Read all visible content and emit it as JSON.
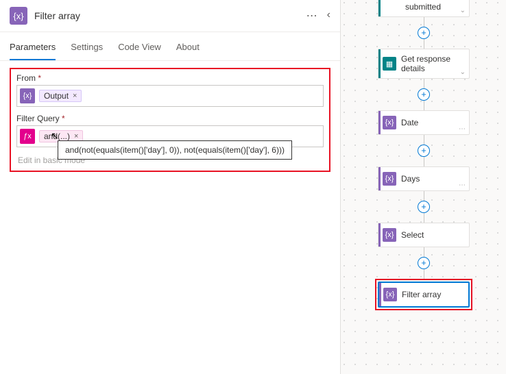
{
  "panel": {
    "title": "Filter array",
    "icon_glyph": "{x}",
    "tabs": [
      "Parameters",
      "Settings",
      "Code View",
      "About"
    ],
    "active_tab": 0
  },
  "form": {
    "from_label": "From",
    "from_token": "Output",
    "query_label": "Filter Query",
    "query_token": "and(...)",
    "edit_link": "Edit in basic mode"
  },
  "tooltip": "and(not(equals(item()['day'], 0)), not(equals(item()['day'], 6)))",
  "flow_nodes": {
    "n0": "submitted",
    "n1": "Get response details",
    "n2": "Date",
    "n3": "Days",
    "n4": "Select",
    "n5": "Filter array"
  },
  "glyphs": {
    "plus": "+",
    "x": "×",
    "dots": "⋯",
    "chevron_left": "‹",
    "caret": "⌄",
    "cursor": "↖"
  }
}
